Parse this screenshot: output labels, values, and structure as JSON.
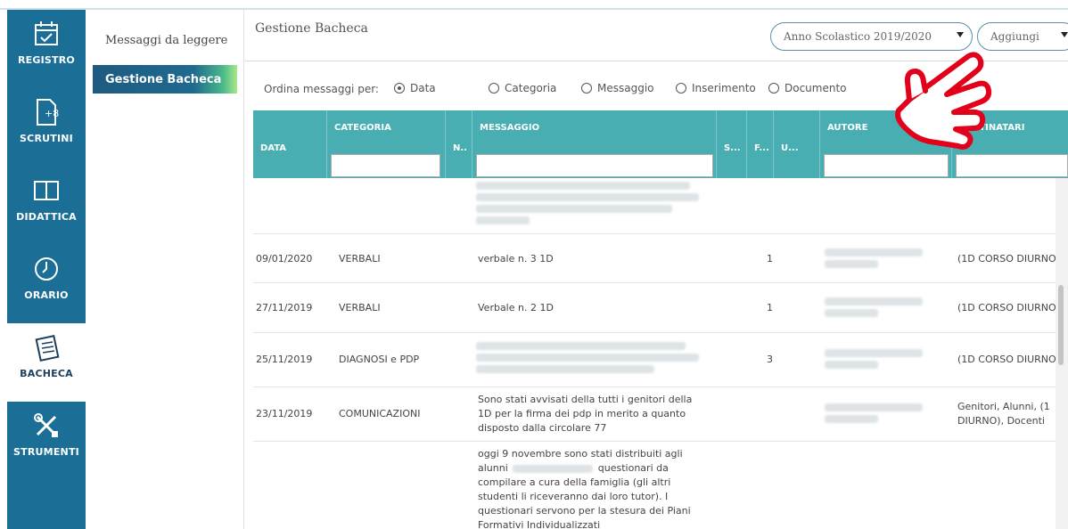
{
  "nav": {
    "items": [
      {
        "label": "REGISTRO",
        "icon": "calendar-check-icon"
      },
      {
        "label": "SCRUTINI",
        "icon": "document-plus-icon"
      },
      {
        "label": "DIDATTICA",
        "icon": "book-icon"
      },
      {
        "label": "ORARIO",
        "icon": "clock-icon"
      },
      {
        "label": "BACHECA",
        "icon": "bulletin-board-icon",
        "active": true
      },
      {
        "label": "STRUMENTI",
        "icon": "tools-icon"
      }
    ]
  },
  "submenu": {
    "items": [
      {
        "label": "Messaggi da leggere"
      },
      {
        "label": "Gestione Bacheca",
        "active": true
      }
    ]
  },
  "header": {
    "title": "Gestione Bacheca",
    "year_select": "Anno Scolastico 2019/2020",
    "add_select": "Aggiungi"
  },
  "sort": {
    "label": "Ordina messaggi per:",
    "options": [
      "Data",
      "Categoria",
      "Messaggio",
      "Inserimento",
      "Documento"
    ],
    "selected": "Data"
  },
  "table": {
    "columns": [
      "DATA",
      "CATEGORIA",
      "N..",
      "MESSAGGIO",
      "S...",
      "F...",
      "U...",
      "AUTORE",
      "DESTINATARI"
    ],
    "rows": [
      {
        "date": "",
        "category": "",
        "message": "",
        "f": "",
        "recipients": ""
      },
      {
        "date": "09/01/2020",
        "category": "VERBALI",
        "message": "verbale n. 3 1D",
        "f": "1",
        "recipients": "(1D CORSO DIURNO"
      },
      {
        "date": "27/11/2019",
        "category": "VERBALI",
        "message": "Verbale n. 2 1D",
        "f": "1",
        "recipients": "(1D CORSO DIURNO"
      },
      {
        "date": "25/11/2019",
        "category": "DIAGNOSI e PDP",
        "message": "",
        "f": "3",
        "recipients": "(1D CORSO DIURNO"
      },
      {
        "date": "23/11/2019",
        "category": "COMUNICAZIONI",
        "message": "Sono stati avvisati della tutti i genitori della 1D per la firma dei pdp in merito a quanto disposto dalla circolare 77",
        "f": "",
        "recipients": "Genitori, Alunni, (1 DIURNO), Docenti"
      },
      {
        "date": "",
        "category": "",
        "message_parts": [
          "oggi 9 novembre sono stati distribuiti agli alunni",
          "questionari da compilare a cura della famiglia (gli altri studenti li riceveranno dai loro tutor). I questionari servono per la stesura dei Piani Formativi Individualizzati"
        ],
        "f": "",
        "recipients": ""
      }
    ]
  },
  "colors": {
    "nav_bg": "#1b6f97",
    "table_header": "#48aeb1",
    "hand_outline": "#e2001a"
  }
}
